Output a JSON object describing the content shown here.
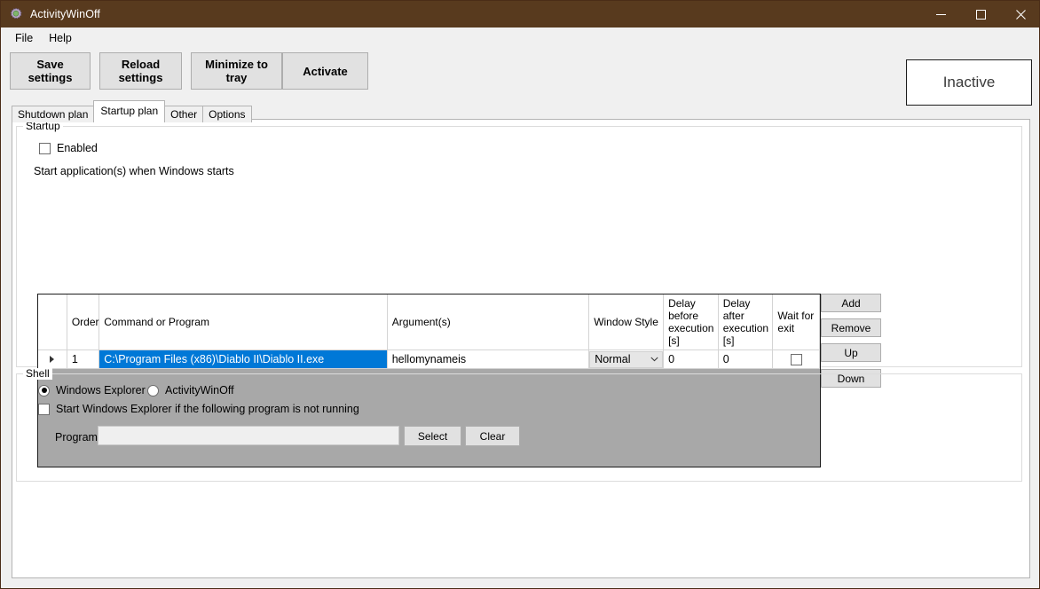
{
  "window": {
    "title": "ActivityWinOff",
    "icon": "gear-icon",
    "titlebar_color": "#583a1e",
    "minimize": "─",
    "maximize": "□",
    "close": "✕"
  },
  "menubar": {
    "items": [
      {
        "label": "File"
      },
      {
        "label": "Help"
      }
    ]
  },
  "toolbar": {
    "buttons": [
      {
        "label": "Save settings"
      },
      {
        "label": "Reload settings"
      },
      {
        "label": "Minimize to tray"
      },
      {
        "label": "Activate"
      }
    ]
  },
  "status": {
    "label": "Inactive",
    "color": "#3b3b3b"
  },
  "tabs": [
    {
      "label": "Shutdown plan",
      "active": false
    },
    {
      "label": "Startup plan",
      "active": true
    },
    {
      "label": "Other",
      "active": false
    },
    {
      "label": "Options",
      "active": false
    }
  ],
  "startup_group": {
    "legend": "Startup",
    "enabled_checkbox": {
      "label": "Enabled",
      "checked": false
    },
    "instruction": "Start application(s) when Windows starts",
    "grid": {
      "columns": [
        {
          "label": ""
        },
        {
          "label": "Order"
        },
        {
          "label": "Command or Program"
        },
        {
          "label": "Argument(s)"
        },
        {
          "label": "Window Style"
        },
        {
          "label": "Delay before execution [s]"
        },
        {
          "label": "Delay after execution [s]"
        },
        {
          "label": "Wait for exit"
        }
      ],
      "rows": [
        {
          "selected": true,
          "row_marker": "▶",
          "order": "1",
          "command": "C:\\Program Files (x86)\\Diablo II\\Diablo II.exe",
          "arguments": "hellomynameis",
          "window_style": "Normal",
          "delay_before": "0",
          "delay_after": "0",
          "wait_for_exit": false
        }
      ]
    },
    "side_buttons": [
      {
        "label": "Add"
      },
      {
        "label": "Remove"
      },
      {
        "label": "Up"
      },
      {
        "label": "Down"
      }
    ]
  },
  "shell_group": {
    "legend": "Shell",
    "radios": [
      {
        "label": "Windows Explorer",
        "checked": true
      },
      {
        "label": "ActivityWinOff",
        "checked": false
      }
    ],
    "start_explorer_checkbox": {
      "label": "Start Windows Explorer if the following program is not running",
      "checked": false
    },
    "program_label": "Program",
    "program_value": "",
    "program_placeholder": "",
    "select_button": "Select",
    "clear_button": "Clear"
  }
}
